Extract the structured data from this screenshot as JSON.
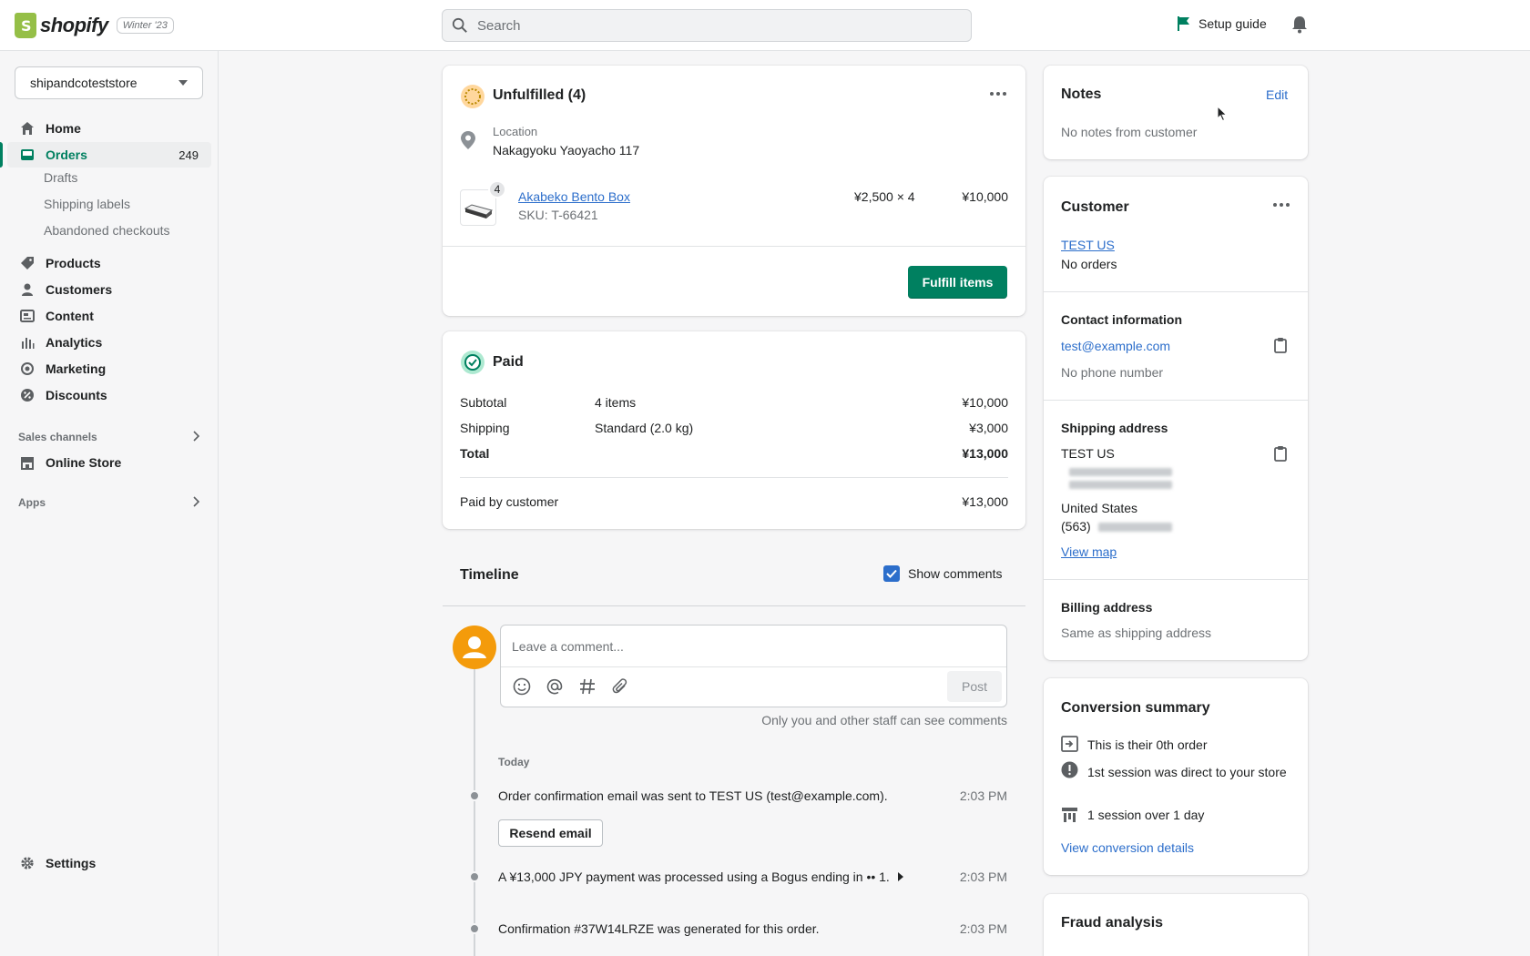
{
  "topbar": {
    "logo_text": "shopify",
    "edition": "Winter '23",
    "search_placeholder": "Search",
    "setup_guide": "Setup guide"
  },
  "sidebar": {
    "store_name": "shipandcoteststore",
    "items": [
      {
        "label": "Home"
      },
      {
        "label": "Orders",
        "count": "249"
      },
      {
        "label": "Products"
      },
      {
        "label": "Customers"
      },
      {
        "label": "Content"
      },
      {
        "label": "Analytics"
      },
      {
        "label": "Marketing"
      },
      {
        "label": "Discounts"
      }
    ],
    "orders_sub": [
      "Drafts",
      "Shipping labels",
      "Abandoned checkouts"
    ],
    "sales_channels": "Sales channels",
    "online_store": "Online Store",
    "apps": "Apps",
    "settings": "Settings"
  },
  "unfulfilled": {
    "title": "Unfulfilled (4)",
    "location_label": "Location",
    "location_value": "Nakagyoku Yaoyacho 117",
    "item": {
      "qty_badge": "4",
      "name": "Akabeko Bento Box",
      "sku": "SKU: T-66421",
      "unit_price": "¥2,500 × 4",
      "total": "¥10,000"
    },
    "fulfill_button": "Fulfill items"
  },
  "paid": {
    "title": "Paid",
    "rows": [
      {
        "label": "Subtotal",
        "detail": "4 items",
        "amount": "¥10,000"
      },
      {
        "label": "Shipping",
        "detail": "Standard (2.0 kg)",
        "amount": "¥3,000"
      },
      {
        "label": "Total",
        "detail": "",
        "amount": "¥13,000"
      }
    ],
    "paid_by_label": "Paid by customer",
    "paid_by_amount": "¥13,000"
  },
  "timeline": {
    "title": "Timeline",
    "show_comments": "Show comments",
    "comment_placeholder": "Leave a comment...",
    "post_button": "Post",
    "staff_note": "Only you and other staff can see comments",
    "day": "Today",
    "events": [
      {
        "text": "Order confirmation email was sent to TEST US (test@example.com).",
        "time": "2:03 PM"
      },
      {
        "text": "A ¥13,000 JPY payment was processed using a Bogus ending in •• 1.",
        "time": "2:03 PM"
      },
      {
        "text": "Confirmation #37W14LRZE was generated for this order.",
        "time": "2:03 PM"
      }
    ],
    "resend_button": "Resend email"
  },
  "notes": {
    "title": "Notes",
    "edit": "Edit",
    "body": "No notes from customer"
  },
  "customer": {
    "title": "Customer",
    "name": "TEST US",
    "orders": "No orders",
    "contact_title": "Contact information",
    "email": "test@example.com",
    "phone": "No phone number",
    "shipping_title": "Shipping address",
    "ship_name": "TEST US",
    "ship_country": "United States",
    "ship_phone_prefix": "(563)",
    "view_map": "View map",
    "billing_title": "Billing address",
    "billing_body": "Same as shipping address"
  },
  "conversion": {
    "title": "Conversion summary",
    "lines": [
      "This is their 0th order",
      "1st session was direct to your store",
      "1 session over 1 day"
    ],
    "link": "View conversion details"
  },
  "fraud": {
    "title": "Fraud analysis"
  }
}
